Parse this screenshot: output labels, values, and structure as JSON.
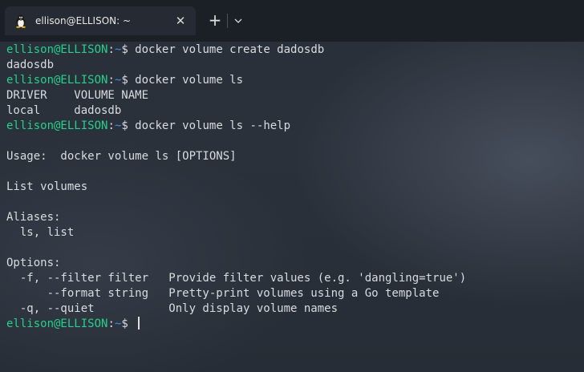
{
  "tab": {
    "title": "ellison@ELLISON: ~",
    "icon": "linux-penguin-icon",
    "close_glyph": "✕"
  },
  "titlebar": {
    "new_tab_glyph": "+",
    "dropdown_icon": "chevron-down-icon"
  },
  "colors": {
    "prompt_user": "#23d18b",
    "prompt_path": "#3b8eea",
    "text": "#d8dbe0"
  },
  "prompt": {
    "user": "ellison@ELLISON",
    "colon": ":",
    "path": "~",
    "dollar": "$ "
  },
  "lines": [
    {
      "type": "prompt",
      "command": "docker volume create dadosdb"
    },
    {
      "type": "output",
      "text": "dadosdb"
    },
    {
      "type": "prompt",
      "command": "docker volume ls"
    },
    {
      "type": "output",
      "text": "DRIVER    VOLUME NAME"
    },
    {
      "type": "output",
      "text": "local     dadosdb"
    },
    {
      "type": "prompt",
      "command": "docker volume ls --help"
    },
    {
      "type": "output",
      "text": ""
    },
    {
      "type": "output",
      "text": "Usage:  docker volume ls [OPTIONS]"
    },
    {
      "type": "output",
      "text": ""
    },
    {
      "type": "output",
      "text": "List volumes"
    },
    {
      "type": "output",
      "text": ""
    },
    {
      "type": "output",
      "text": "Aliases:"
    },
    {
      "type": "output",
      "text": "  ls, list"
    },
    {
      "type": "output",
      "text": ""
    },
    {
      "type": "output",
      "text": "Options:"
    },
    {
      "type": "output",
      "text": "  -f, --filter filter   Provide filter values (e.g. 'dangling=true')"
    },
    {
      "type": "output",
      "text": "      --format string   Pretty-print volumes using a Go template"
    },
    {
      "type": "output",
      "text": "  -q, --quiet           Only display volume names"
    },
    {
      "type": "prompt",
      "command": "",
      "cursor": true
    }
  ]
}
